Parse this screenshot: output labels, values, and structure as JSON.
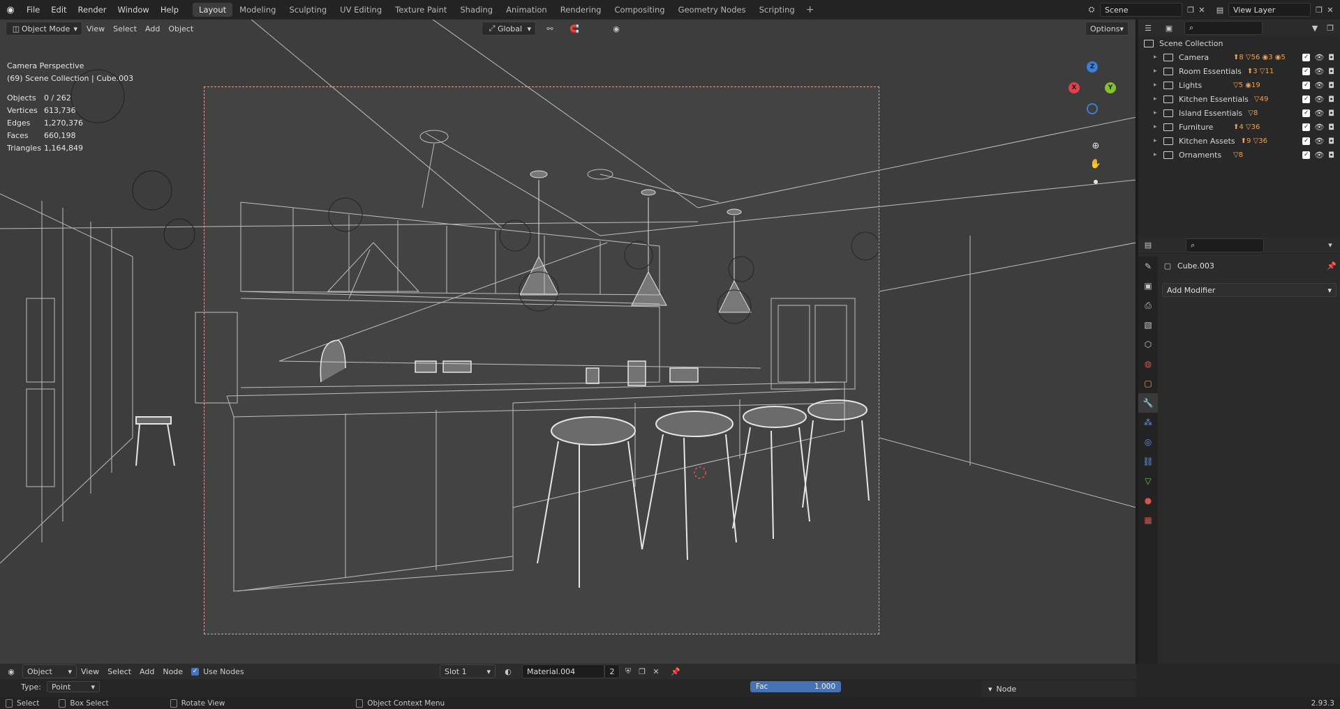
{
  "topbar": {
    "menu": [
      "File",
      "Edit",
      "Render",
      "Window",
      "Help"
    ],
    "workspaces": [
      "Layout",
      "Modeling",
      "Sculpting",
      "UV Editing",
      "Texture Paint",
      "Shading",
      "Animation",
      "Rendering",
      "Compositing",
      "Geometry Nodes",
      "Scripting"
    ],
    "active_workspace": "Layout",
    "scene": "Scene",
    "view_layer": "View Layer"
  },
  "viewport": {
    "mode": "Object Mode",
    "menus": [
      "View",
      "Select",
      "Add",
      "Object"
    ],
    "transform_orientation": "Global",
    "options_label": "Options",
    "camera_label": "Camera Perspective",
    "collection_label": "(69) Scene Collection | Cube.003",
    "stats": [
      {
        "k": "Objects",
        "v": "0 / 262"
      },
      {
        "k": "Vertices",
        "v": "613,736"
      },
      {
        "k": "Edges",
        "v": "1,270,376"
      },
      {
        "k": "Faces",
        "v": "660,198"
      },
      {
        "k": "Triangles",
        "v": "1,164,849"
      }
    ],
    "gizmo": {
      "x": "X",
      "y": "Y",
      "z": "Z"
    }
  },
  "outliner": {
    "root": "Scene Collection",
    "collections": [
      {
        "name": "Camera",
        "badges": "⬆8 ▽56 ◉3 ◉5"
      },
      {
        "name": "Room Essentials",
        "badges": "⬆3 ▽11"
      },
      {
        "name": "Lights",
        "badges": "▽5 ◉19"
      },
      {
        "name": "Kitchen Essentials",
        "badges": "▽49"
      },
      {
        "name": "Island Essentials",
        "badges": "▽8"
      },
      {
        "name": "Furniture",
        "badges": "⬆4 ▽36"
      },
      {
        "name": "Kitchen Assets",
        "badges": "⬆9 ▽36"
      },
      {
        "name": "Ornaments",
        "badges": "▽8"
      }
    ]
  },
  "properties": {
    "object_name": "Cube.003",
    "add_modifier": "Add Modifier"
  },
  "node_editor": {
    "editor_type": "Object",
    "menus": [
      "View",
      "Select",
      "Add",
      "Node"
    ],
    "use_nodes_label": "Use Nodes",
    "slot": "Slot 1",
    "material": "Material.004",
    "users": "2",
    "type_label": "Type:",
    "type_value": "Point",
    "fac_label": "Fac",
    "fac_value": "1.000",
    "node_panel": "Node"
  },
  "statusbar": {
    "select": "Select",
    "box_select": "Box Select",
    "rotate_view": "Rotate View",
    "context_menu": "Object Context Menu",
    "version": "2.93.3"
  },
  "colors": {
    "accent_blue": "#4772b3",
    "axis_x": "#e04050",
    "axis_y": "#84c02a",
    "axis_z": "#3b7fd6",
    "outliner_badge": "#e8a35a"
  }
}
